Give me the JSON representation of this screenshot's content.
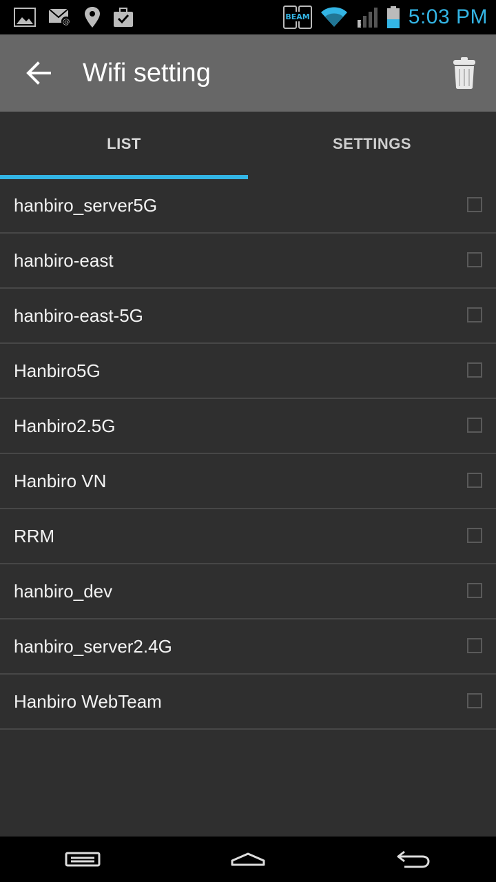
{
  "status_bar": {
    "time": "5:03 PM",
    "beam_label": "BEAM",
    "accent_color": "#33b5e5"
  },
  "app_bar": {
    "title": "Wifi setting",
    "back_icon": "arrow-back-icon",
    "trash_icon": "trash-icon"
  },
  "tabs": [
    {
      "label": "LIST",
      "active": true
    },
    {
      "label": "SETTINGS",
      "active": false
    }
  ],
  "wifi_list": [
    {
      "name": "hanbiro_server5G",
      "checked": false
    },
    {
      "name": "hanbiro-east",
      "checked": false
    },
    {
      "name": "hanbiro-east-5G",
      "checked": false
    },
    {
      "name": "Hanbiro5G",
      "checked": false
    },
    {
      "name": "Hanbiro2.5G",
      "checked": false
    },
    {
      "name": "Hanbiro VN",
      "checked": false
    },
    {
      "name": "RRM",
      "checked": false
    },
    {
      "name": "hanbiro_dev",
      "checked": false
    },
    {
      "name": "hanbiro_server2.4G",
      "checked": false
    },
    {
      "name": "Hanbiro WebTeam",
      "checked": false
    }
  ],
  "nav_bar": {
    "recent_icon": "recent-apps-icon",
    "home_icon": "home-icon",
    "back_icon": "back-icon"
  }
}
